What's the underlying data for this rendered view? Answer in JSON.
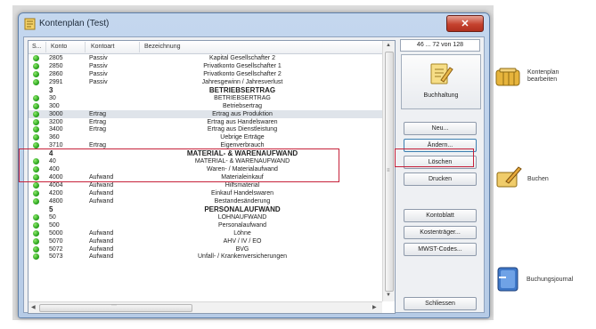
{
  "window": {
    "title": "Kontenplan (Test)",
    "close_glyph": "✕"
  },
  "list": {
    "columns": {
      "s": "S...",
      "konto": "Konto",
      "art": "Kontoart",
      "bez": "Bezeichnung"
    },
    "rows": [
      {
        "dot": true,
        "konto": "2805",
        "art": "Passiv",
        "bez": "Kapital Gesellschafter 2",
        "level": 3
      },
      {
        "dot": true,
        "konto": "2850",
        "art": "Passiv",
        "bez": "Privatkonto Gesellschafter 1",
        "level": 3
      },
      {
        "dot": true,
        "konto": "2860",
        "art": "Passiv",
        "bez": "Privatkonto Gesellschafter 2",
        "level": 3
      },
      {
        "dot": true,
        "konto": "2991",
        "art": "Passiv",
        "bez": "Jahresgewinn / Jahresverlust",
        "level": 3
      },
      {
        "dot": false,
        "konto": "3",
        "art": "",
        "bez": "BETRIEBSERTRAG",
        "level": 1
      },
      {
        "dot": true,
        "konto": "30",
        "art": "",
        "bez": "BETRIEBSERTRAG",
        "level": 2
      },
      {
        "dot": true,
        "konto": "300",
        "art": "",
        "bez": "Betriebsertrag",
        "level": 3
      },
      {
        "dot": true,
        "konto": "3000",
        "art": "Ertrag",
        "bez": "Ertrag aus Produktion",
        "level": 3,
        "selected": true
      },
      {
        "dot": true,
        "konto": "3200",
        "art": "Ertrag",
        "bez": "Ertrag aus Handelswaren",
        "level": 3
      },
      {
        "dot": true,
        "konto": "3400",
        "art": "Ertrag",
        "bez": "Ertrag aus Dienstleistung",
        "level": 3
      },
      {
        "dot": true,
        "konto": "360",
        "art": "",
        "bez": "Uebrige Erträge",
        "level": 3
      },
      {
        "dot": true,
        "konto": "3710",
        "art": "Ertrag",
        "bez": "Eigenverbrauch",
        "level": 3
      },
      {
        "dot": false,
        "konto": "4",
        "art": "",
        "bez": "MATERIAL- & WARENAUFWAND",
        "level": 1
      },
      {
        "dot": true,
        "konto": "40",
        "art": "",
        "bez": "MATERIAL- & WARENAUFWAND",
        "level": 2
      },
      {
        "dot": true,
        "konto": "400",
        "art": "",
        "bez": "Waren- / Materialaufwand",
        "level": 3
      },
      {
        "dot": true,
        "konto": "4000",
        "art": "Aufwand",
        "bez": "Materialeinkauf",
        "level": 3
      },
      {
        "dot": true,
        "konto": "4004",
        "art": "Aufwand",
        "bez": "Hilfsmaterial",
        "level": 3
      },
      {
        "dot": true,
        "konto": "4200",
        "art": "Aufwand",
        "bez": "Einkauf Handelswaren",
        "level": 3
      },
      {
        "dot": true,
        "konto": "4800",
        "art": "Aufwand",
        "bez": "Bestandesänderung",
        "level": 3
      },
      {
        "dot": false,
        "konto": "5",
        "art": "",
        "bez": "PERSONALAUFWAND",
        "level": 1
      },
      {
        "dot": true,
        "konto": "50",
        "art": "",
        "bez": "LOHNAUFWAND",
        "level": 2
      },
      {
        "dot": true,
        "konto": "500",
        "art": "",
        "bez": "Personalaufwand",
        "level": 3
      },
      {
        "dot": true,
        "konto": "5000",
        "art": "Aufwand",
        "bez": "Löhne",
        "level": 3
      },
      {
        "dot": true,
        "konto": "5070",
        "art": "Aufwand",
        "bez": "AHV / IV / EO",
        "level": 3
      },
      {
        "dot": true,
        "konto": "5072",
        "art": "Aufwand",
        "bez": "BVG",
        "level": 3
      },
      {
        "dot": true,
        "konto": "5073",
        "art": "Aufwand",
        "bez": "Unfall- / Krankenversicherungen",
        "level": 3
      }
    ]
  },
  "panel": {
    "counter": "46 ... 72 von 128",
    "buchhaltung": "Buchhaltung",
    "buttons": {
      "neu": "Neu...",
      "aendern": "Ändern...",
      "loeschen": "Löschen",
      "drucken": "Drucken",
      "kontoblatt": "Kontoblatt",
      "kostentraeger": "Kostenträger...",
      "mwst": "MWST-Codes...",
      "schliessen": "Schliessen"
    }
  },
  "shortcuts": {
    "kontenplan": [
      "Kontenplan",
      "bearbeiten"
    ],
    "buchen": "Buchen",
    "journal": "Buchungsjournal"
  },
  "colors": {
    "highlight_border": "#c6213a",
    "account_dot": "#1f9a15"
  }
}
